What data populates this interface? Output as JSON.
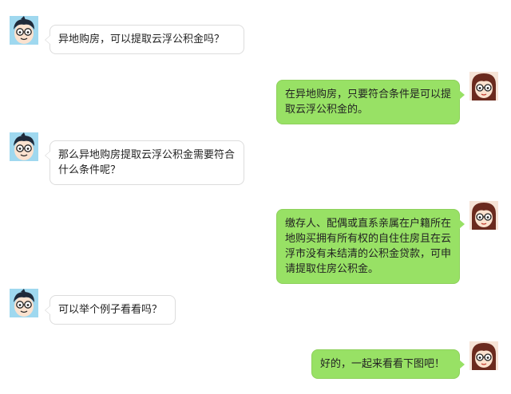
{
  "colors": {
    "background": "#ffffff",
    "left_bubble": "#ffffff",
    "left_bubble_border": "#dcdcdc",
    "right_bubble": "#98e165",
    "text": "#222222"
  },
  "messages": [
    {
      "side": "left",
      "avatar": "boy-avatar-icon",
      "text": "异地购房，可以提取云浮公积金吗？"
    },
    {
      "side": "right",
      "avatar": "girl-avatar-icon",
      "text": "在异地购房，只要符合条件是可以提取云浮公积金的。"
    },
    {
      "side": "left",
      "avatar": "boy-avatar-icon",
      "text": "那么异地购房提取云浮公积金需要符合什么条件呢？"
    },
    {
      "side": "right",
      "avatar": "girl-avatar-icon",
      "text": "缴存人、配偶或直系亲属在户籍所在地购买拥有所有权的自住住房且在云浮市没有未结清的公积金贷款，可申请提取住房公积金。"
    },
    {
      "side": "left",
      "avatar": "boy-avatar-icon",
      "text": "可以举个例子看看吗？"
    },
    {
      "side": "right",
      "avatar": "girl-avatar-icon",
      "text": "好的，一起来看看下图吧！"
    }
  ]
}
